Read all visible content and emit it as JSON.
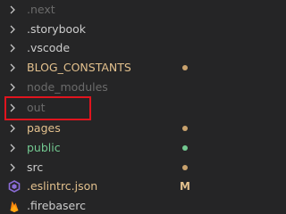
{
  "explorer": {
    "items": [
      {
        "label": ".next",
        "type": "folder",
        "color": "#6b6b6b"
      },
      {
        "label": ".storybook",
        "type": "folder",
        "color": "#cccccc"
      },
      {
        "label": ".vscode",
        "type": "folder",
        "color": "#cccccc"
      },
      {
        "label": "BLOG_CONSTANTS",
        "type": "folder",
        "color": "#e2c08d",
        "status_dot": "#c9a26d"
      },
      {
        "label": "node_modules",
        "type": "folder",
        "color": "#6b6b6b"
      },
      {
        "label": "out",
        "type": "folder",
        "color": "#6b6b6b"
      },
      {
        "label": "pages",
        "type": "folder",
        "color": "#e2c08d",
        "status_dot": "#c9a26d"
      },
      {
        "label": "public",
        "type": "folder",
        "color": "#73c991",
        "status_dot": "#73c991"
      },
      {
        "label": "src",
        "type": "folder",
        "color": "#cccccc",
        "status_dot": "#c9a26d"
      },
      {
        "label": ".eslintrc.json",
        "type": "file",
        "icon": "eslint-icon",
        "color": "#e2c08d",
        "badge": "M"
      },
      {
        "label": ".firebaserc",
        "type": "file",
        "icon": "firebase-icon",
        "color": "#cccccc"
      }
    ]
  },
  "colors": {
    "background": "#252526",
    "highlight_border": "#e0141e",
    "chevron": "#c5c5c5"
  }
}
